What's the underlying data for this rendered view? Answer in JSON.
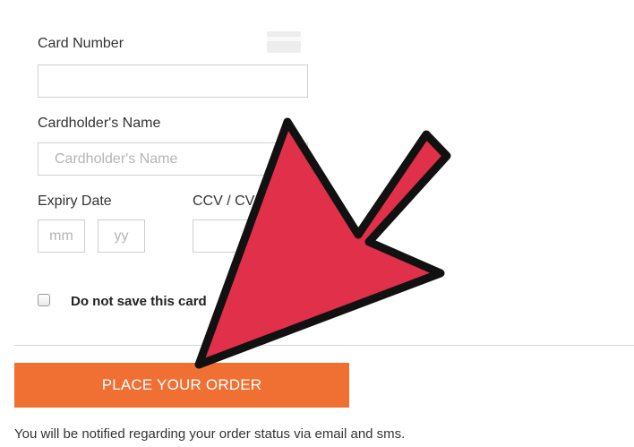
{
  "payment_form": {
    "card_number": {
      "label": "Card Number",
      "value": "",
      "placeholder": ""
    },
    "cardholder_name": {
      "label": "Cardholder's Name",
      "value": "",
      "placeholder": "Cardholder's Name"
    },
    "expiry": {
      "label": "Expiry Date",
      "month_placeholder": "mm",
      "year_placeholder": "yy"
    },
    "ccv": {
      "label": "CCV / CV",
      "value": ""
    },
    "save_card": {
      "label": "Do not save this card",
      "checked": false
    },
    "order_button_label": "PLACE YOUR ORDER",
    "notice": "You will be notified regarding your order status via email and sms."
  },
  "icons": {
    "card": "credit-card-icon",
    "pointer": "red-arrow-icon"
  },
  "colors": {
    "order_button": "#f07034",
    "arrow_fill": "#e0304a",
    "arrow_outline": "#111111"
  }
}
